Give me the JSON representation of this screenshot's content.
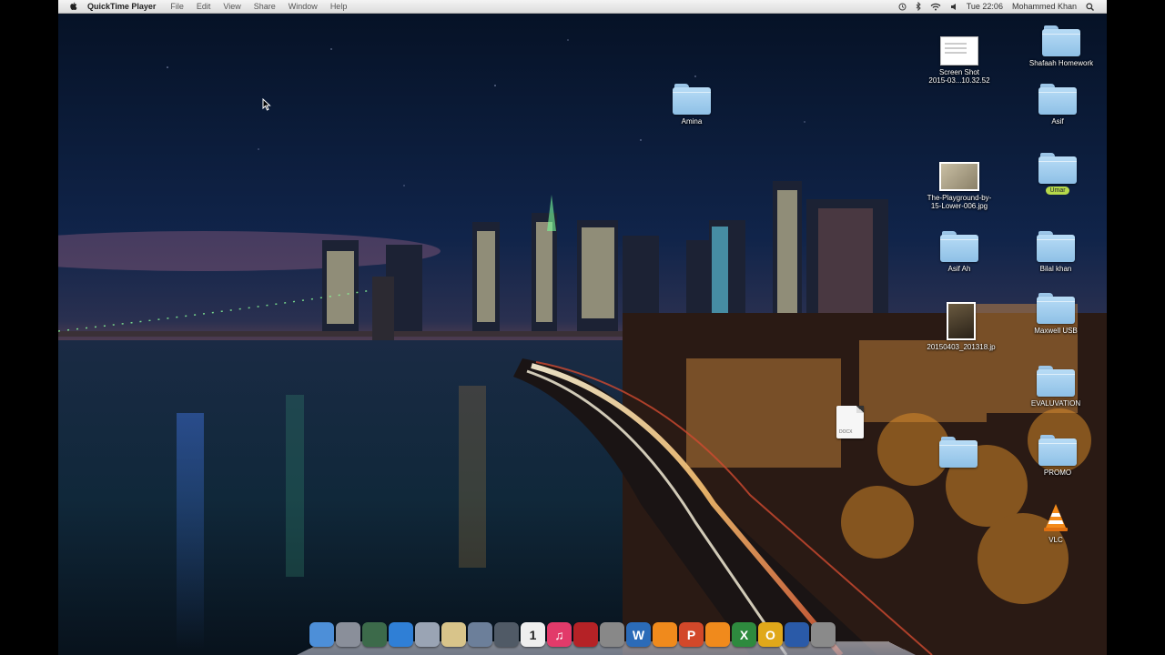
{
  "menubar": {
    "app_name": "QuickTime Player",
    "menus": [
      "File",
      "Edit",
      "View",
      "Share",
      "Window",
      "Help"
    ],
    "clock": "Tue 22:06",
    "user": "Mohammed Khan"
  },
  "desktop": {
    "icons": [
      {
        "id": "screen-shot",
        "label": "Screen Shot\n2015-03...10.32.52",
        "kind": "screenshot"
      },
      {
        "id": "shafaah-homework",
        "label": "Shafaah Homework",
        "kind": "folder"
      },
      {
        "id": "amina",
        "label": "Amina",
        "kind": "folder"
      },
      {
        "id": "asif",
        "label": "Asif",
        "kind": "folder"
      },
      {
        "id": "playground",
        "label": "The-Playground-by-\n15-Lower-006.jpg",
        "kind": "photo"
      },
      {
        "id": "umar",
        "label": "Umar",
        "kind": "folder-tagged"
      },
      {
        "id": "asif-a",
        "label": "Asif Ah",
        "kind": "folder"
      },
      {
        "id": "bilal-khan",
        "label": "Bilal khan",
        "kind": "folder"
      },
      {
        "id": "photo-jpg",
        "label": "20150403_201318.jp",
        "kind": "photo-portrait"
      },
      {
        "id": "maxwell-usb",
        "label": "Maxwell USB",
        "kind": "folder"
      },
      {
        "id": "evaluvation",
        "label": "EVALUVATION",
        "kind": "folder"
      },
      {
        "id": "docx",
        "label": "",
        "kind": "doc",
        "ext": "DOCX"
      },
      {
        "id": "promo",
        "label": "PROMO",
        "kind": "folder"
      },
      {
        "id": "blurred-folder",
        "label": "",
        "kind": "folder"
      },
      {
        "id": "vlc",
        "label": "VLC",
        "kind": "vlc"
      }
    ]
  },
  "dock": {
    "apps": [
      {
        "name": "finder",
        "glyph": "",
        "color": "#4d8fd8"
      },
      {
        "name": "launchpad",
        "glyph": "",
        "color": "#8a8f9a"
      },
      {
        "name": "mission-control",
        "glyph": "",
        "color": "#3c6a4a"
      },
      {
        "name": "safari",
        "glyph": "",
        "color": "#2f7fd6"
      },
      {
        "name": "preview",
        "glyph": "",
        "color": "#9aa4b4"
      },
      {
        "name": "notes",
        "glyph": "",
        "color": "#d8c48a"
      },
      {
        "name": "system-preferences",
        "glyph": "",
        "color": "#6c7f9a"
      },
      {
        "name": "facetime",
        "glyph": "",
        "color": "#505a66"
      },
      {
        "name": "calendar",
        "glyph": "1",
        "color": "#eeeeee"
      },
      {
        "name": "itunes",
        "glyph": "♫",
        "color": "#e23a6a"
      },
      {
        "name": "photo-booth",
        "glyph": "",
        "color": "#b52226"
      },
      {
        "name": "screenshot-tool",
        "glyph": "",
        "color": "#888888"
      },
      {
        "name": "word",
        "glyph": "W",
        "color": "#2b6bb8"
      },
      {
        "name": "vlc-dock",
        "glyph": "",
        "color": "#f08a1c"
      },
      {
        "name": "powerpoint",
        "glyph": "P",
        "color": "#d2482a"
      },
      {
        "name": "vlc-2",
        "glyph": "",
        "color": "#f08a1c"
      },
      {
        "name": "excel",
        "glyph": "X",
        "color": "#2e8a3e"
      },
      {
        "name": "outlook",
        "glyph": "O",
        "color": "#e0a81a"
      },
      {
        "name": "quicktime",
        "glyph": "",
        "color": "#2a5aa8"
      },
      {
        "name": "trash",
        "glyph": "",
        "color": "#8a8a8a"
      }
    ]
  }
}
